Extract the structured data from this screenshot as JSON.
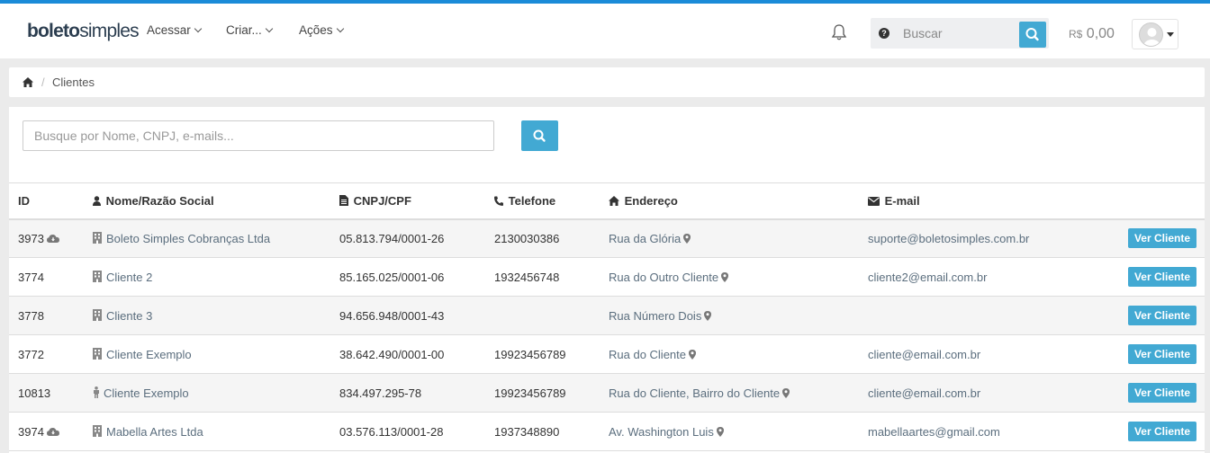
{
  "brand": {
    "part1": "boleto",
    "part2": "simples"
  },
  "nav": [
    {
      "label": "Acessar"
    },
    {
      "label": "Criar..."
    },
    {
      "label": "Ações"
    }
  ],
  "search": {
    "placeholder": "Buscar"
  },
  "balance": {
    "currency": "R$",
    "amount": "0,00"
  },
  "breadcrumb": {
    "current": "Clientes"
  },
  "filter": {
    "placeholder": "Busque por Nome, CNPJ, e-mails..."
  },
  "table": {
    "headers": {
      "id": "ID",
      "name": "Nome/Razão Social",
      "doc": "CNPJ/CPF",
      "phone": "Telefone",
      "address": "Endereço",
      "email": "E-mail"
    },
    "action_label": "Ver Cliente",
    "rows": [
      {
        "id": "3973",
        "cloud": true,
        "type": "company",
        "name": "Boleto Simples Cobranças Ltda",
        "doc": "05.813.794/0001-26",
        "phone": "2130030386",
        "address": "Rua da Glória",
        "email": "suporte@boletosimples.com.br"
      },
      {
        "id": "3774",
        "cloud": false,
        "type": "company",
        "name": "Cliente 2",
        "doc": "85.165.025/0001-06",
        "phone": "1932456748",
        "address": "Rua do Outro Cliente",
        "email": "cliente2@email.com.br"
      },
      {
        "id": "3778",
        "cloud": false,
        "type": "company",
        "name": "Cliente 3",
        "doc": "94.656.948/0001-43",
        "phone": "",
        "address": "Rua Número Dois",
        "email": ""
      },
      {
        "id": "3772",
        "cloud": false,
        "type": "company",
        "name": "Cliente Exemplo",
        "doc": "38.642.490/0001-00",
        "phone": "19923456789",
        "address": "Rua do Cliente",
        "email": "cliente@email.com.br"
      },
      {
        "id": "10813",
        "cloud": false,
        "type": "person",
        "name": "Cliente Exemplo",
        "doc": "834.497.295-78",
        "phone": "19923456789",
        "address": "Rua do Cliente, Bairro do Cliente",
        "email": "cliente@email.com.br"
      },
      {
        "id": "3974",
        "cloud": true,
        "type": "company",
        "name": "Mabella Artes Ltda",
        "doc": "03.576.113/0001-28",
        "phone": "1937348890",
        "address": "Av. Washington Luis",
        "email": "mabellaartes@gmail.com"
      }
    ]
  },
  "colors": {
    "accent": "#42a9d3",
    "topbar_border": "#1a8bd8"
  }
}
